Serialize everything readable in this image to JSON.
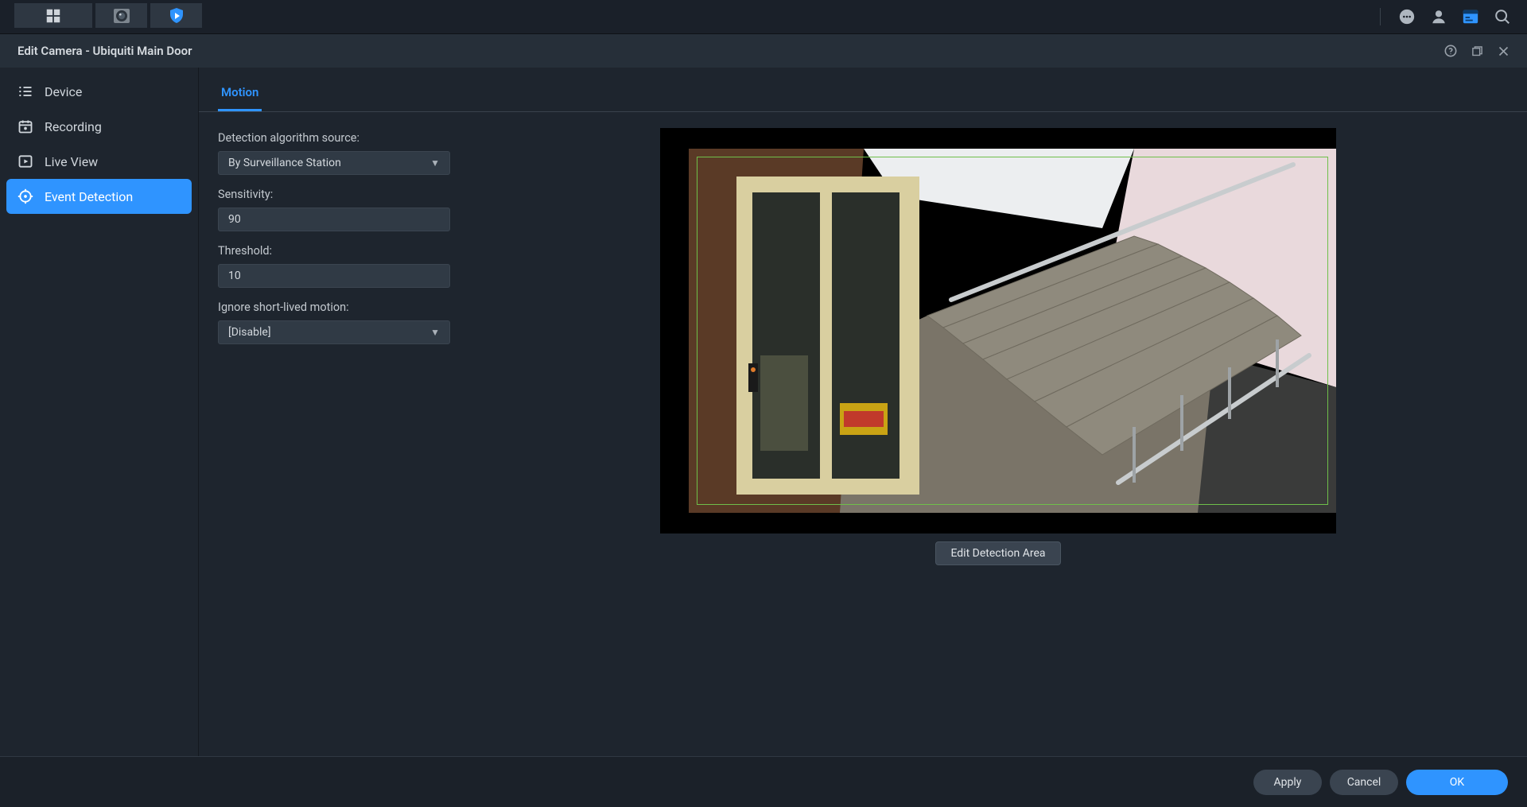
{
  "window": {
    "title": "Edit Camera - Ubiquiti Main Door"
  },
  "sidebar": {
    "items": [
      {
        "label": "Device"
      },
      {
        "label": "Recording"
      },
      {
        "label": "Live View"
      },
      {
        "label": "Event Detection"
      }
    ],
    "active_index": 3
  },
  "tabs": {
    "motion": "Motion"
  },
  "form": {
    "detection_source_label": "Detection algorithm source:",
    "detection_source_value": "By Surveillance Station",
    "sensitivity_label": "Sensitivity:",
    "sensitivity_value": "90",
    "threshold_label": "Threshold:",
    "threshold_value": "10",
    "ignore_short_label": "Ignore short-lived motion:",
    "ignore_short_value": "[Disable]"
  },
  "preview": {
    "edit_area_button": "Edit Detection Area"
  },
  "footer": {
    "apply": "Apply",
    "cancel": "Cancel",
    "ok": "OK"
  },
  "colors": {
    "accent": "#2f94ff",
    "detection_border": "#6fbf4a"
  }
}
